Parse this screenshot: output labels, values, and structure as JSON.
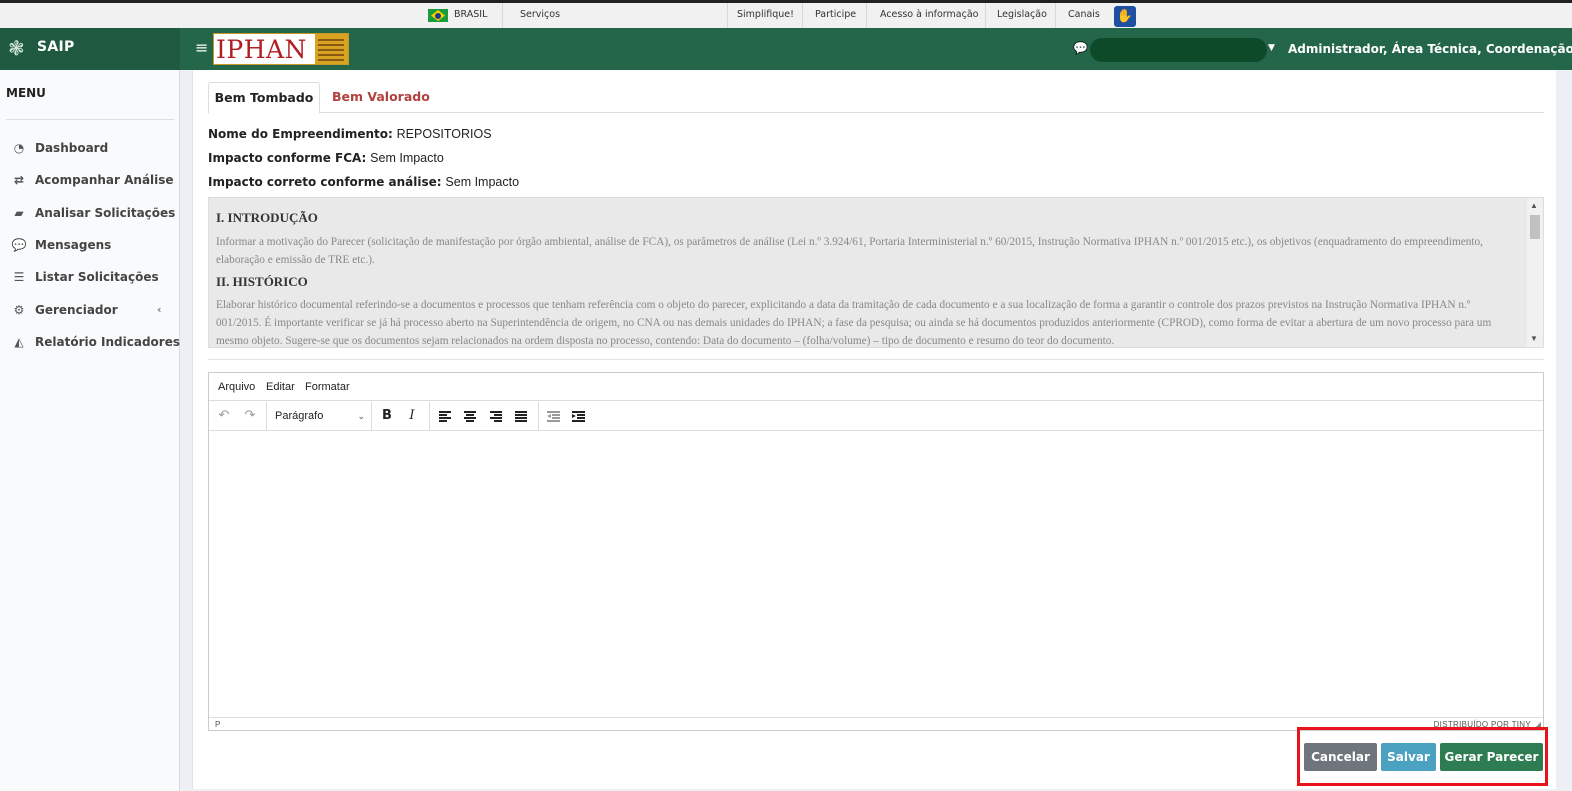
{
  "gov_bar": {
    "brasil": "BRASIL",
    "servicos": "Serviços",
    "links": [
      "Simplifique!",
      "Participe",
      "Acesso à informação",
      "Legislação",
      "Canais"
    ]
  },
  "header": {
    "app_name": "SAIP",
    "brand_logo": "IPHAN",
    "user_role": "Administrador, Área Técnica, Coordenação..."
  },
  "sidebar": {
    "title": "MENU",
    "items": [
      {
        "label": "Dashboard",
        "icon": "dashboard-icon"
      },
      {
        "label": "Acompanhar Análise",
        "icon": "exchange-icon"
      },
      {
        "label": "Analisar Solicitações",
        "icon": "book-icon"
      },
      {
        "label": "Mensagens",
        "icon": "comments-icon"
      },
      {
        "label": "Listar Solicitações",
        "icon": "list-icon"
      },
      {
        "label": "Gerenciador",
        "icon": "cogs-icon"
      },
      {
        "label": "Relatório Indicadores",
        "icon": "area-chart-icon"
      }
    ]
  },
  "tabs": [
    {
      "label": "Bem Tombado",
      "active": true
    },
    {
      "label": "Bem Valorado",
      "active": false
    }
  ],
  "info": {
    "empreendimento_label": "Nome do Empreendimento:",
    "empreendimento_value": "REPOSITORIOS",
    "impacto_fca_label": "Impacto conforme FCA:",
    "impacto_fca_value": "Sem Impacto",
    "impacto_correto_label": "Impacto correto conforme análise:",
    "impacto_correto_value": "Sem Impacto"
  },
  "preview": {
    "h1": "I. INTRODUÇÃO",
    "p1": "Informar a motivação do Parecer (solicitação de manifestação por órgão ambiental, análise de FCA), os parâmetros de análise (Lei n.º 3.924/61, Portaria Interministerial n.º 60/2015, Instrução Normativa IPHAN n.º 001/2015 etc.), os objetivos (enquadramento do empreendimento, elaboração e emissão de TRE etc.).",
    "h2": "II. HISTÓRICO",
    "p2": "Elaborar histórico documental referindo-se a documentos e processos que tenham referência com o objeto do parecer, explicitando a data da tramitação de cada documento e a sua localização de forma a garantir o controle dos prazos previstos na Instrução Normativa IPHAN n.º 001/2015. É importante verificar se já há processo aberto na Superintendência de origem, no CNA ou nas demais unidades do IPHAN; a fase da pesquisa; ou ainda se há documentos produzidos anteriormente (CPROD), como forma de evitar a abertura de um novo processo para um mesmo objeto. Sugere-se que os documentos sejam relacionados na ordem disposta no processo, contendo: Data do documento – (folha/volume) – tipo de documento e resumo do teor do documento."
  },
  "editor": {
    "menu": [
      "Arquivo",
      "Editar",
      "Formatar"
    ],
    "block_format": "Parágrafo",
    "status_path": "P",
    "status_brand": "DISTRIBUÍDO POR TINY"
  },
  "actions": {
    "cancel": "Cancelar",
    "save": "Salvar",
    "generate": "Gerar Parecer"
  },
  "colors": {
    "header_green": "#24664a",
    "cancel_btn": "#6e757c",
    "save_btn": "#4aa1c0",
    "generate_btn": "#2e7d52",
    "highlight": "#e8131b"
  }
}
